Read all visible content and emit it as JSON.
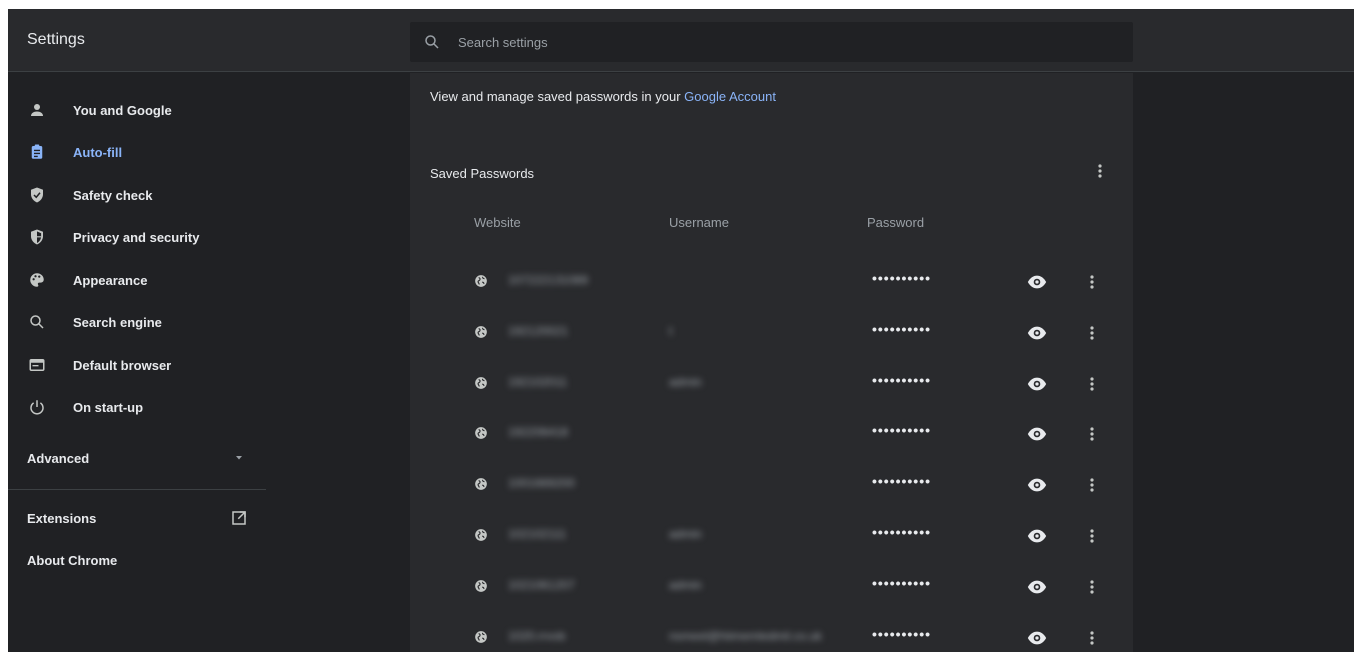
{
  "header": {
    "title": "Settings",
    "search_placeholder": "Search settings",
    "search_icon": "search-icon"
  },
  "sidebar": {
    "items": [
      {
        "label": "You and Google",
        "icon": "person-icon",
        "active": false
      },
      {
        "label": "Auto-fill",
        "icon": "clipboard-icon",
        "active": true
      },
      {
        "label": "Safety check",
        "icon": "shield-check-icon",
        "active": false
      },
      {
        "label": "Privacy and security",
        "icon": "privacy-shield-icon",
        "active": false
      },
      {
        "label": "Appearance",
        "icon": "palette-icon",
        "active": false
      },
      {
        "label": "Search engine",
        "icon": "search-icon",
        "active": false
      },
      {
        "label": "Default browser",
        "icon": "browser-window-icon",
        "active": false
      },
      {
        "label": "On start-up",
        "icon": "power-icon",
        "active": false
      }
    ],
    "advanced_label": "Advanced",
    "extensions_label": "Extensions",
    "about_label": "About Chrome"
  },
  "main": {
    "intro_text": "View and manage saved passwords in your ",
    "intro_link": "Google Account",
    "section_title": "Saved Passwords",
    "columns": {
      "website": "Website",
      "username": "Username",
      "password": "Password"
    },
    "passwords": [
      {
        "website": "107222131089",
        "username": "",
        "password": "••••••••••"
      },
      {
        "website": "192120021",
        "username": "t",
        "password": "••••••••••"
      },
      {
        "website": "192102011",
        "username": "admin",
        "password": "••••••••••"
      },
      {
        "website": "192206418",
        "username": "",
        "password": "••••••••••"
      },
      {
        "website": "1001669200",
        "username": "",
        "password": "••••••••••"
      },
      {
        "website": "102102111",
        "username": "admin",
        "password": "••••••••••"
      },
      {
        "website": "1021061207",
        "username": "admin",
        "password": "••••••••••"
      },
      {
        "website": "1020.rrvob",
        "username": "nsmeel@hiimemledmil.co.uk",
        "password": "••••••••••"
      }
    ]
  },
  "colors": {
    "background": "#202124",
    "surface": "#292a2d",
    "accent": "#8ab4f8",
    "text": "#e8eaed",
    "text_secondary": "#9aa0a6"
  }
}
